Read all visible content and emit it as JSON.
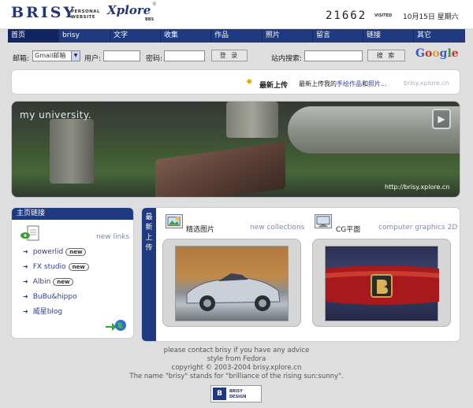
{
  "header": {
    "logo": "BRISY",
    "logo_sub_line1": "PERSONAL",
    "logo_sub_line2": "WEBSITE",
    "xplore": "Xplore",
    "xplore_sub": "BBS",
    "xplore_mark": "©",
    "visit_count": "21662",
    "visit_label": "VISITED",
    "date": "10月15日 星期六"
  },
  "nav": {
    "items": [
      "首页",
      "brisy",
      "文字",
      "收集",
      "作品",
      "照片",
      "留言",
      "链接",
      "其它"
    ],
    "active_index": 0
  },
  "login": {
    "mail_label": "邮箱:",
    "mail_select": "Gmail邮箱",
    "user_label": "用户:",
    "user_value": "",
    "password_label": "密码:",
    "password_value": "",
    "login_button": "登 录",
    "search_label": "站内搜索:",
    "search_value": "",
    "search_button": "搜 索",
    "google": [
      "G",
      "o",
      "o",
      "g",
      "l",
      "e"
    ]
  },
  "announce": {
    "icon": "sun-icon",
    "title": "最新上传",
    "text_prefix": "最新上传我的",
    "text_link1": "手绘作品",
    "text_mid": "和",
    "text_link2": "照片",
    "text_suffix": "...",
    "site": "brisy.xplore.cn"
  },
  "banner": {
    "title": "my university.",
    "url": "http://brisy.xplore.cn",
    "play_icon": "play-icon"
  },
  "left_panel": {
    "title": "主页链接",
    "new_links": "new links",
    "links": [
      {
        "label": "powerlid",
        "new": true
      },
      {
        "label": "FX studio",
        "new": true
      },
      {
        "label": "Albin",
        "new": true
      },
      {
        "label": "BuBu&hippo",
        "new": false
      },
      {
        "label": "威星blog",
        "new": false
      }
    ],
    "badge_text": "new",
    "arrow": "➜"
  },
  "right_panel": {
    "label": "最新上传",
    "col1_title": "精选图片",
    "col1_sub": "new collections",
    "col2_title": "CG平面",
    "col2_sub": "computer graphics 2D"
  },
  "footer": {
    "lines": [
      "please contact brisy if you have any advice",
      "style from Fedora",
      "copyright © 2003-2004 brisy.xplore.cn",
      "The name \"brisy\" stands for \"brilliance of the rising sun:sunny\"."
    ],
    "logo_mark": "B",
    "logo_line1": "BRISY",
    "logo_line2": "DESIGN"
  },
  "colors": {
    "nav_bg": "#1f3a80",
    "link": "#2c3e90",
    "page_bg": "#dedede"
  }
}
